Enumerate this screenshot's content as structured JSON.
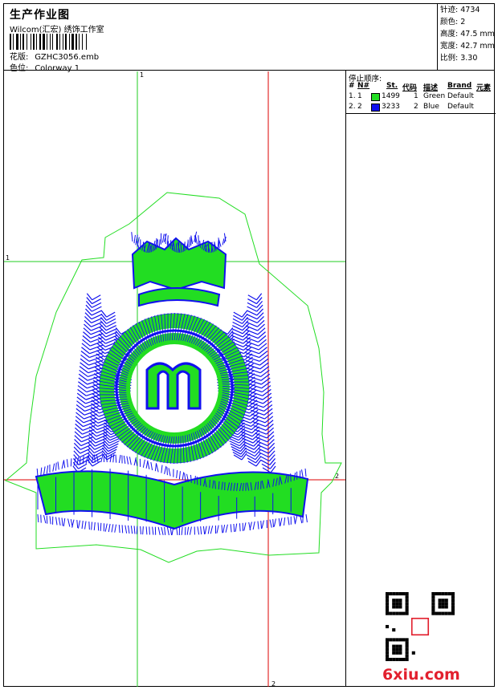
{
  "header": {
    "title": "生产作业图",
    "company": "Wilcom(汇宏) 绣饰工作室",
    "design_label": "花版:",
    "design_value": "GZHC3056.emb",
    "colorway_label": "色位:",
    "colorway_value": "Colorway 1"
  },
  "stats": {
    "stitches_label": "针迹:",
    "stitches_value": "4734",
    "colors_label": "颜色:",
    "colors_value": "2",
    "height_label": "高度:",
    "height_value": "47.5 mm",
    "width_label": "宽度:",
    "width_value": "42.7 mm",
    "scale_label": "比例:",
    "scale_value": "3.30"
  },
  "stop_sequence": {
    "title": "停止顺序:",
    "columns": [
      "#",
      "N#",
      "St.",
      "代码",
      "描述",
      "Brand",
      "元素"
    ],
    "rows": [
      {
        "num": "1.",
        "n": "1",
        "color": "#22dd22",
        "st": "1499",
        "code": "1",
        "desc": "Green",
        "brand": "Default"
      },
      {
        "num": "2.",
        "n": "2",
        "color": "#1010ee",
        "st": "3233",
        "code": "2",
        "desc": "Blue",
        "brand": "Default"
      }
    ]
  },
  "guides": {
    "v1_label": "1",
    "h1_label": "1",
    "h2_label": "2",
    "v2_label": "2"
  },
  "watermark": {
    "site": "6xiu.com"
  },
  "colors": {
    "green_thread": "#22dd22",
    "blue_thread": "#1010ee",
    "guide_green": "#22cc22",
    "guide_red": "#dd0000"
  }
}
